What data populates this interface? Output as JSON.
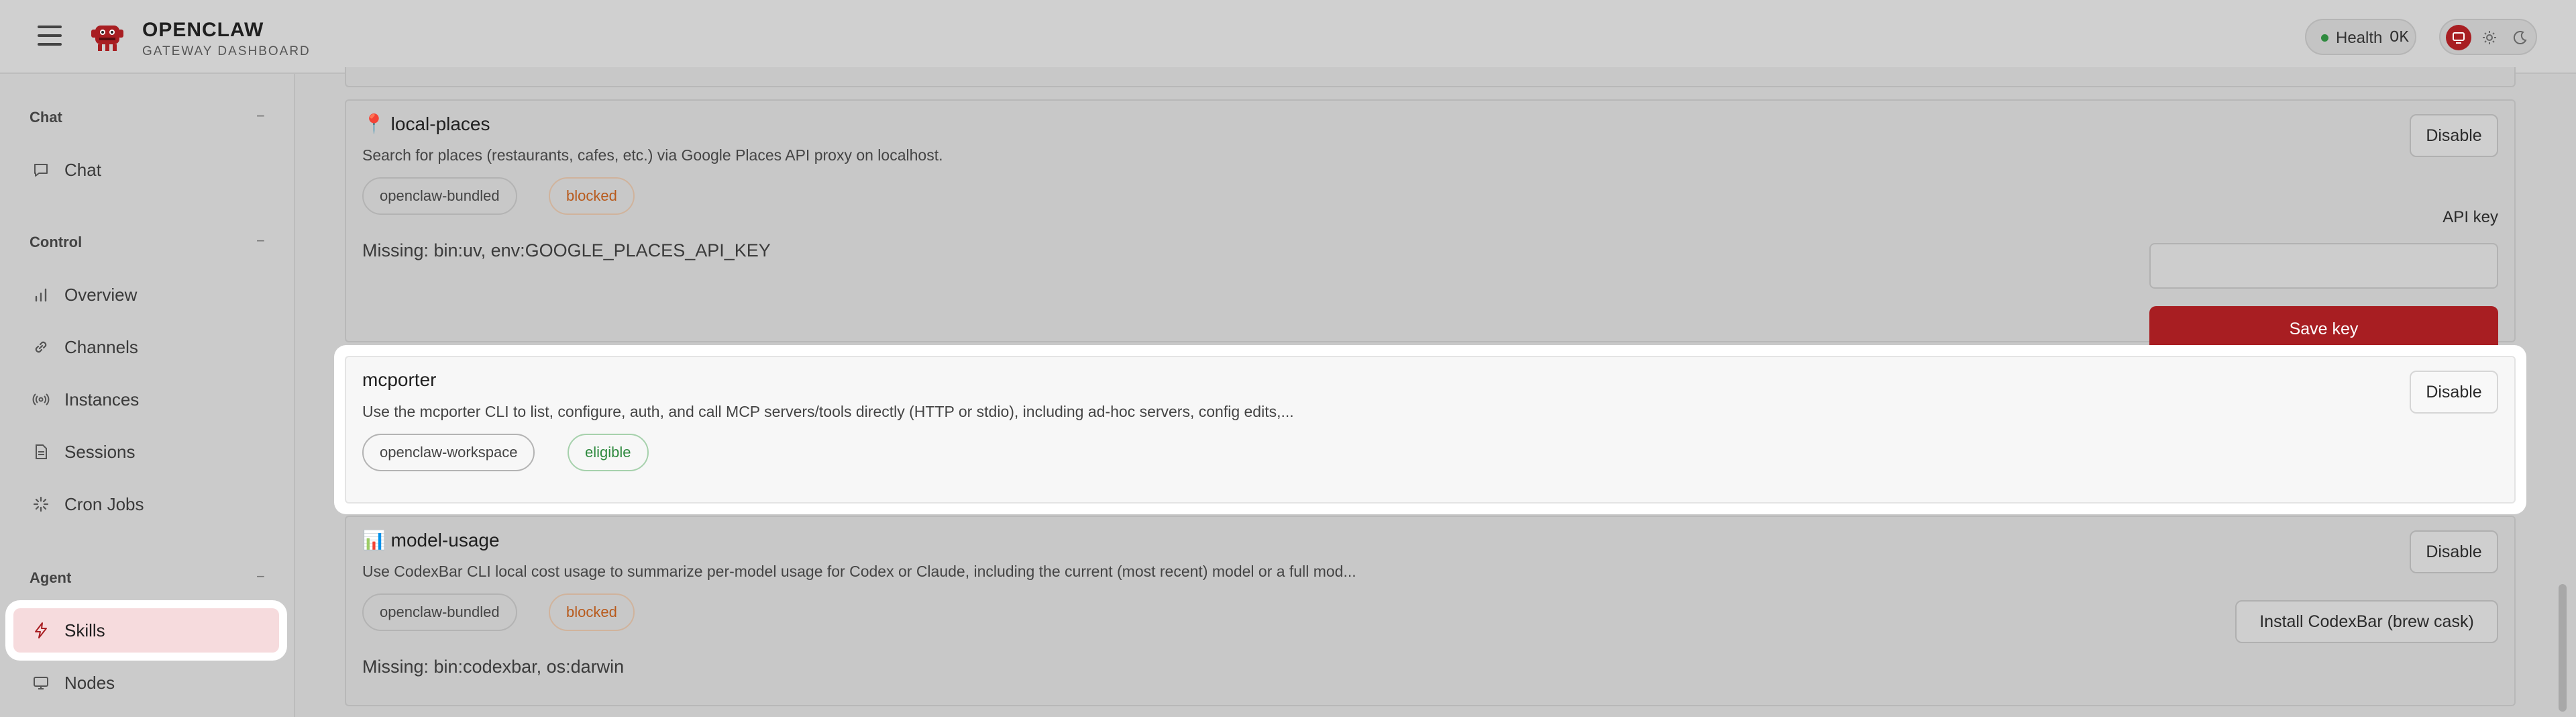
{
  "header": {
    "brand_title": "OPENCLAW",
    "brand_subtitle": "GATEWAY DASHBOARD",
    "health_label": "Health",
    "health_value": "OK",
    "status_color": "#2e8a3e",
    "accent_color": "#a81e22"
  },
  "sidebar": {
    "groups": [
      {
        "title": "Chat",
        "collapse": "−",
        "items": [
          {
            "label": "Chat",
            "icon": "chat-bubble-icon"
          }
        ]
      },
      {
        "title": "Control",
        "collapse": "−",
        "items": [
          {
            "label": "Overview",
            "icon": "bar-chart-icon"
          },
          {
            "label": "Channels",
            "icon": "link-icon"
          },
          {
            "label": "Instances",
            "icon": "broadcast-icon"
          },
          {
            "label": "Sessions",
            "icon": "document-icon"
          },
          {
            "label": "Cron Jobs",
            "icon": "loader-icon"
          }
        ]
      },
      {
        "title": "Agent",
        "collapse": "−",
        "items": [
          {
            "label": "Skills",
            "icon": "lightning-icon",
            "active": true
          },
          {
            "label": "Nodes",
            "icon": "monitor-icon"
          }
        ]
      }
    ]
  },
  "skills": [
    {
      "emoji": "📍",
      "name": "local-places",
      "description": "Search for places (restaurants, cafes, etc.) via Google Places API proxy on localhost.",
      "tags": [
        "openclaw-bundled",
        "blocked"
      ],
      "missing": "Missing: bin:uv, env:GOOGLE_PLACES_API_KEY",
      "toggle_label": "Disable",
      "api_key_label": "API key",
      "api_key_value": "",
      "save_label": "Save key"
    },
    {
      "emoji": "",
      "name": "mcporter",
      "description": "Use the mcporter CLI to list, configure, auth, and call MCP servers/tools directly (HTTP or stdio), including ad-hoc servers, config edits,...",
      "tags": [
        "openclaw-workspace",
        "eligible"
      ],
      "toggle_label": "Disable"
    },
    {
      "emoji": "📊",
      "name": "model-usage",
      "description": "Use CodexBar CLI local cost usage to summarize per-model usage for Codex or Claude, including the current (most recent) model or a full mod...",
      "tags": [
        "openclaw-bundled",
        "blocked"
      ],
      "missing": "Missing: bin:codexbar, os:darwin",
      "toggle_label": "Disable",
      "install_label": "Install CodexBar (brew cask)"
    }
  ]
}
